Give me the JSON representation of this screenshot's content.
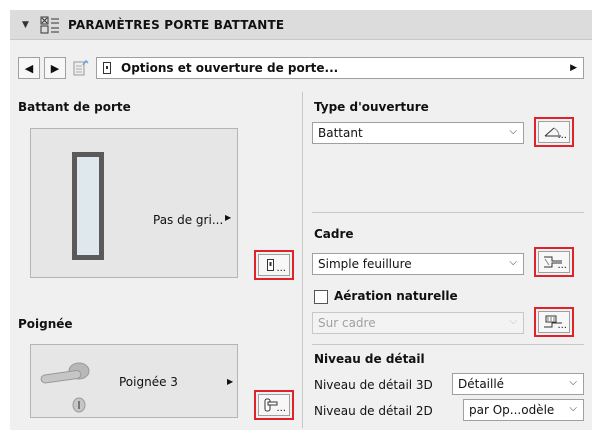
{
  "header": {
    "title": "PARAMÈTRES PORTE BATTANTE"
  },
  "toolbar": {
    "page_select": "Options et ouverture de porte...",
    "prev_glyph": "◀",
    "next_glyph": "▶"
  },
  "left": {
    "door_leaf": {
      "label": "Battant de porte",
      "preview_text": "Pas de gri..."
    },
    "handle": {
      "label": "Poignée",
      "preview_text": "Poignée 3"
    }
  },
  "right": {
    "opening": {
      "label": "Type d'ouverture",
      "value": "Battant"
    },
    "frame": {
      "label": "Cadre",
      "value": "Simple feuillure",
      "vent_label": "Aération naturelle",
      "vent_checked": false,
      "vent_location": "Sur cadre"
    },
    "detail": {
      "title": "Niveau de détail",
      "rows": [
        {
          "label": "Niveau de détail 3D",
          "value": "Détaillé"
        },
        {
          "label": "Niveau de détail 2D",
          "value": "par Op...odèle"
        }
      ]
    }
  },
  "button_text": "...",
  "colors": {
    "highlight": "#e0222b",
    "panel": "#f0f0f0"
  }
}
